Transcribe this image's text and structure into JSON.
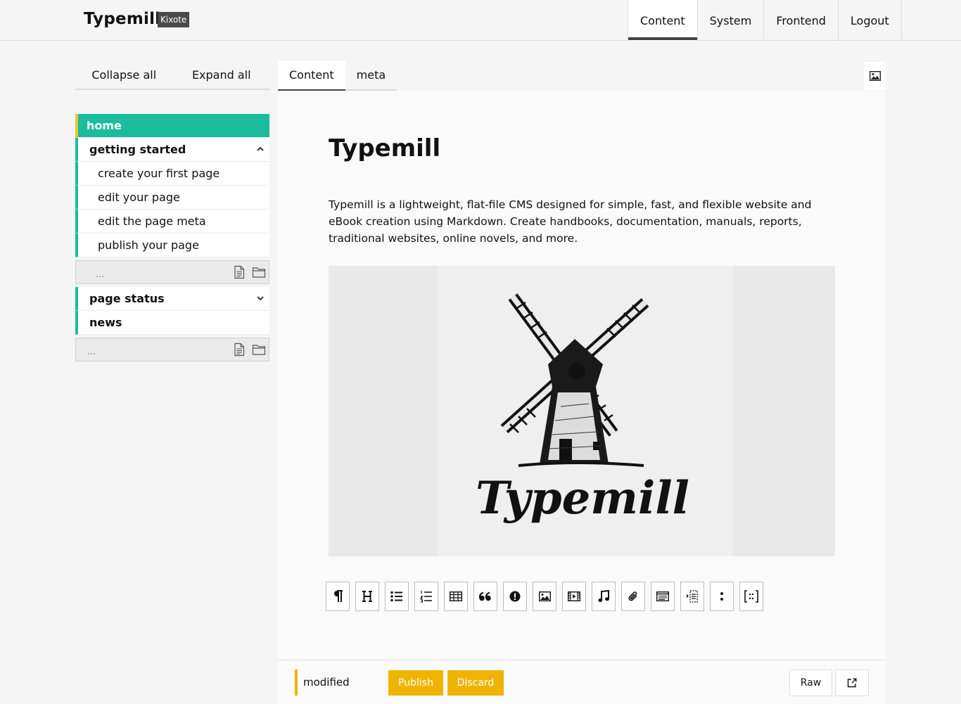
{
  "header": {
    "brand": "Typemill",
    "badge": "Kixote",
    "nav": [
      "Content",
      "System",
      "Frontend",
      "Logout"
    ],
    "active_nav": "Content"
  },
  "sidebar": {
    "collapse_label": "Collapse all",
    "expand_label": "Expand all",
    "items": {
      "home": "home",
      "getting_started": "getting started",
      "create_first_page": "create your first page",
      "edit_page": "edit your page",
      "edit_meta": "edit the page meta",
      "publish_page": "publish your page",
      "page_status": "page status",
      "news": "news"
    },
    "add_placeholder": "..."
  },
  "editor": {
    "tabs": [
      "Content",
      "meta"
    ],
    "active_tab": "Content",
    "title": "Typemill",
    "intro": "Typemill is a lightweight, flat-file CMS designed for simple, fast, and flexible website and eBook creation using Markdown. Create handbooks, documentation, manuals, reports, traditional websites, online novels, and more.",
    "image_caption_text": "Typemill",
    "block_tools": [
      "paragraph-icon",
      "heading-icon",
      "unordered-list-icon",
      "ordered-list-icon",
      "table-icon",
      "quote-icon",
      "notice-icon",
      "image-icon",
      "video-icon",
      "audio-icon",
      "file-icon",
      "code-icon",
      "toc-icon",
      "definition-icon",
      "shortcode-icon"
    ]
  },
  "footer": {
    "status": "modified",
    "publish_label": "Publish",
    "discard_label": "Discard",
    "raw_label": "Raw"
  },
  "colors": {
    "accent": "#1abc9c",
    "warning": "#f0b400",
    "active_marker": "#f0c330"
  }
}
